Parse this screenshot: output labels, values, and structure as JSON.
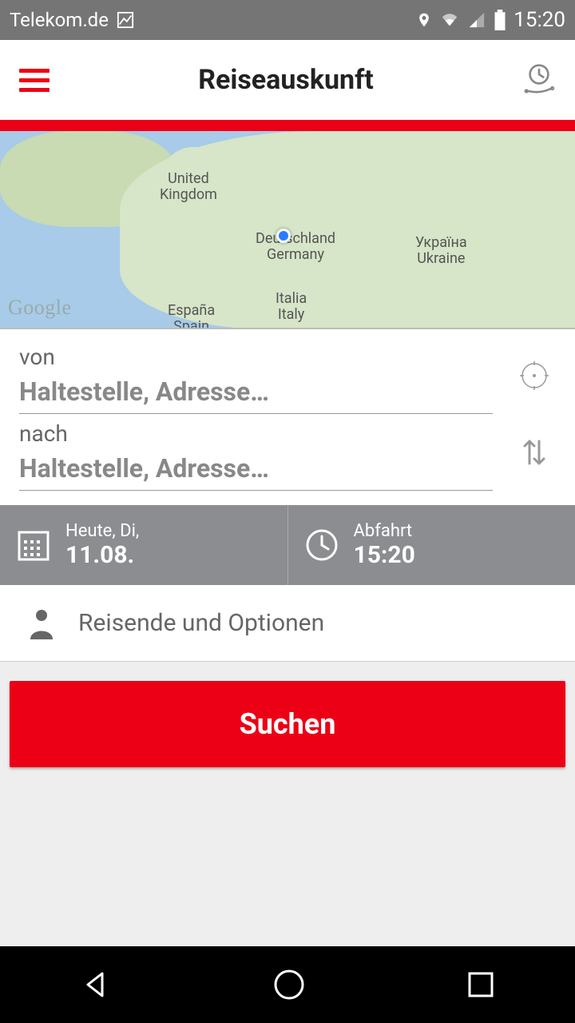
{
  "status": {
    "carrier": "Telekom.de",
    "time": "15:20"
  },
  "header": {
    "title": "Reiseauskunft"
  },
  "map": {
    "labels": {
      "uk": "United\nKingdom",
      "de": "Deutschland\nGermany",
      "ua": "Україна\nUkraine",
      "it": "Italia\nItaly",
      "es": "España\nSpain"
    },
    "attribution": "Google"
  },
  "form": {
    "from_label": "von",
    "from_placeholder": "Haltestelle, Adresse…",
    "to_label": "nach",
    "to_placeholder": "Haltestelle, Adresse…"
  },
  "datetime": {
    "date_label": "Heute, Di,",
    "date_value": "11.08.",
    "time_label": "Abfahrt",
    "time_value": "15:20"
  },
  "options": {
    "label": "Reisende und Optionen"
  },
  "search": {
    "label": "Suchen"
  }
}
